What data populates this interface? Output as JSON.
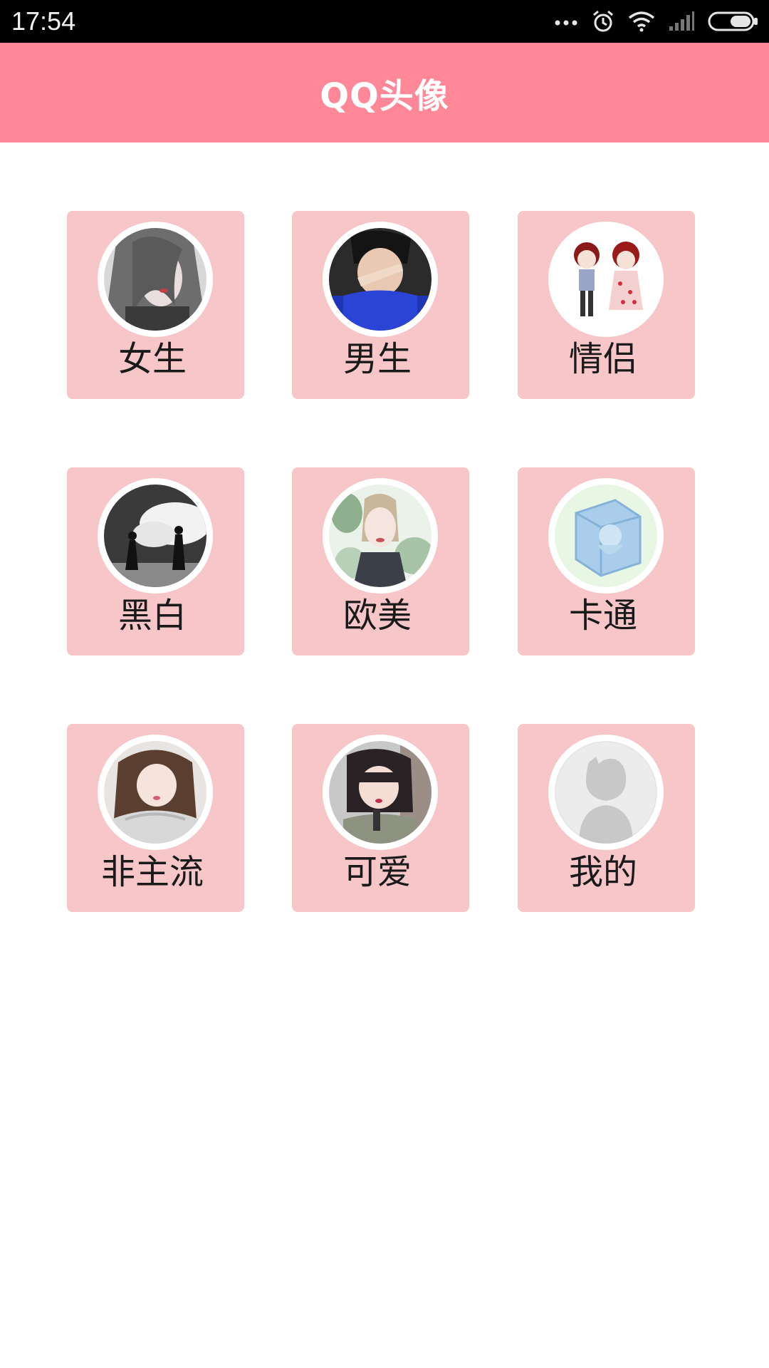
{
  "status_bar": {
    "time": "17:54",
    "icons": [
      "more-dots-icon",
      "alarm-icon",
      "wifi-icon",
      "signal-icon",
      "battery-icon"
    ]
  },
  "header": {
    "title": "QQ头像",
    "color": "#ff8797"
  },
  "categories": [
    {
      "label": "女生",
      "icon": "avatar-girl"
    },
    {
      "label": "男生",
      "icon": "avatar-boy"
    },
    {
      "label": "情侣",
      "icon": "avatar-couple"
    },
    {
      "label": "黑白",
      "icon": "avatar-black-white"
    },
    {
      "label": "欧美",
      "icon": "avatar-western"
    },
    {
      "label": "卡通",
      "icon": "avatar-cartoon"
    },
    {
      "label": "非主流",
      "icon": "avatar-non-mainstream"
    },
    {
      "label": "可爱",
      "icon": "avatar-cute"
    },
    {
      "label": "我的",
      "icon": "avatar-default-user"
    }
  ],
  "tile_color": "#f6c6c8"
}
